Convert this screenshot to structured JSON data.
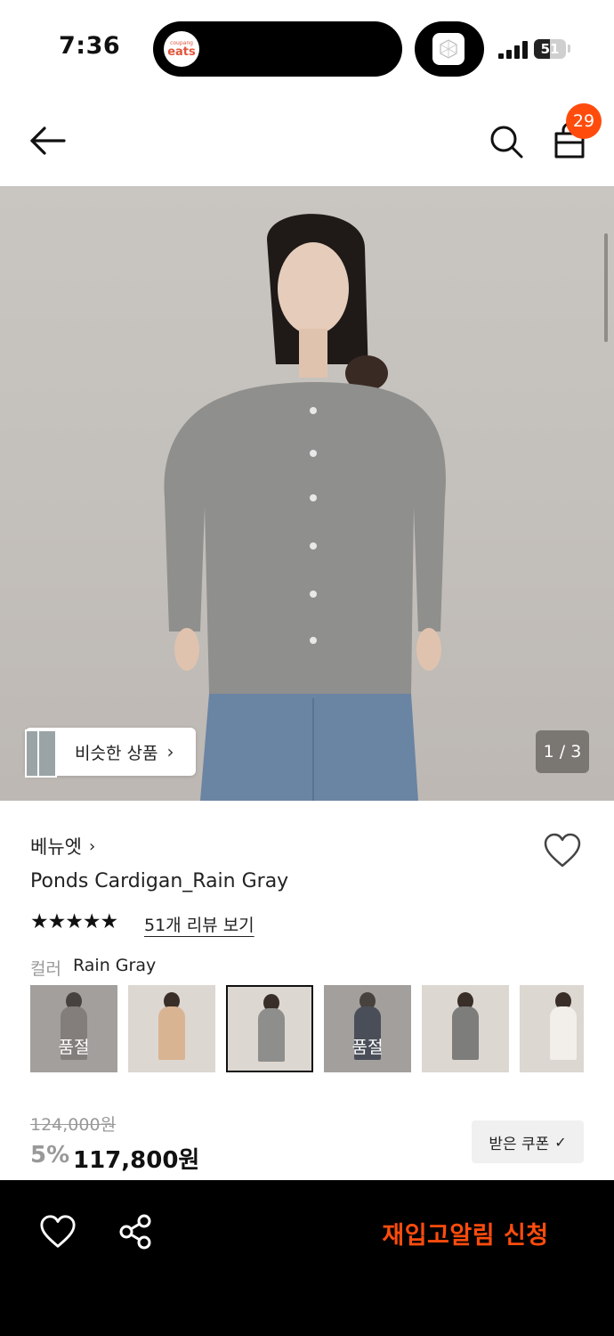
{
  "status_bar": {
    "time": "7:36",
    "app_badge": {
      "small": "coupang",
      "big": "eats"
    },
    "battery_level": "51"
  },
  "header": {
    "back_icon": "arrow-left-icon",
    "search_icon": "search-icon",
    "cart_icon": "shopping-bag-icon",
    "cart_count": "29"
  },
  "hero": {
    "similar_products_label": "비슷한 상품",
    "page_counter": "1 / 3"
  },
  "product": {
    "brand": "베뉴엣",
    "name": "Ponds Cardigan_Rain Gray",
    "rating_stars": "★★★★★",
    "review_link": "51개 리뷰 보기",
    "color_label": "컬러",
    "color_value": "Rain Gray",
    "swatches": [
      {
        "sold_out": "품절"
      },
      {
        "sold_out": ""
      },
      {
        "sold_out": ""
      },
      {
        "sold_out": "품절"
      },
      {
        "sold_out": ""
      },
      {
        "sold_out": ""
      }
    ],
    "original_price": "124,000원",
    "discount_rate": "5%",
    "sale_price": "117,800원",
    "coupon_button": "받은 쿠폰",
    "coupon_check": "✓"
  },
  "bottom_bar": {
    "wishlist_icon": "heart-icon",
    "share_icon": "share-icon",
    "restock_button": "재입고알림 신청"
  },
  "colors": {
    "accent": "#ff4c0d",
    "bottom_bar_bg": "#000000"
  }
}
